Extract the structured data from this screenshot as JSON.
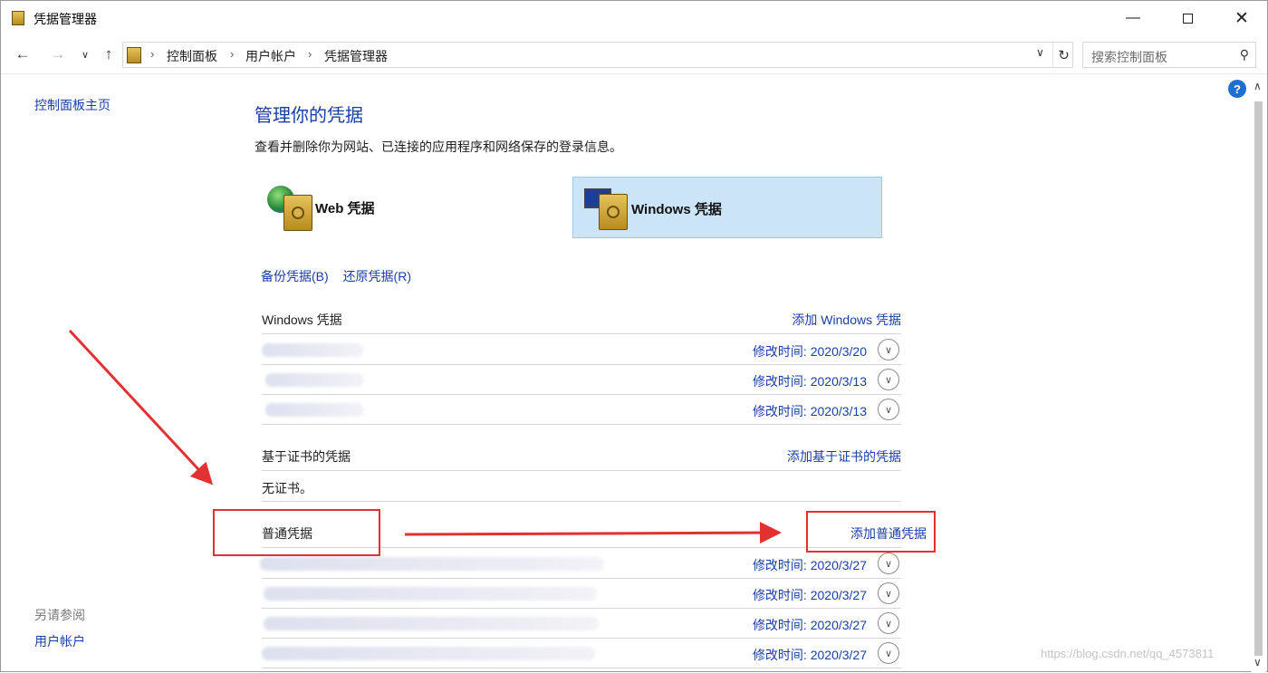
{
  "window": {
    "title": "凭据管理器"
  },
  "address": {
    "crumbs": [
      "控制面板",
      "用户帐户",
      "凭据管理器"
    ],
    "search_placeholder": "搜索控制面板"
  },
  "left": {
    "home": "控制面板主页",
    "see_also": "另请参阅",
    "user_accounts": "用户帐户"
  },
  "main": {
    "title": "管理你的凭据",
    "description": "查看并删除你为网站、已连接的应用程序和网络保存的登录信息。",
    "web_label": "Web 凭据",
    "windows_label": "Windows 凭据",
    "backup": "备份凭据(B)",
    "restore": "还原凭据(R)"
  },
  "windows_section": {
    "title": "Windows 凭据",
    "add": "添加 Windows 凭据",
    "rows": [
      {
        "date": "修改时间:  2020/3/20"
      },
      {
        "date": "修改时间:  2020/3/13"
      },
      {
        "date": "修改时间:  2020/3/13"
      }
    ]
  },
  "cert_section": {
    "title": "基于证书的凭据",
    "add": "添加基于证书的凭据",
    "none": "无证书。"
  },
  "generic_section": {
    "title": "普通凭据",
    "add": "添加普通凭据",
    "rows": [
      {
        "date": "修改时间:  2020/3/27"
      },
      {
        "date": "修改时间:  2020/3/27"
      },
      {
        "date": "修改时间:  2020/3/27"
      },
      {
        "date": "修改时间:  2020/3/27"
      }
    ]
  },
  "help": "?",
  "watermark": "https://blog.csdn.net/qq_4573811",
  "colors": {
    "link": "#1a3ea8",
    "annotation": "#e33131",
    "selected_tile": "#cce4f7"
  }
}
